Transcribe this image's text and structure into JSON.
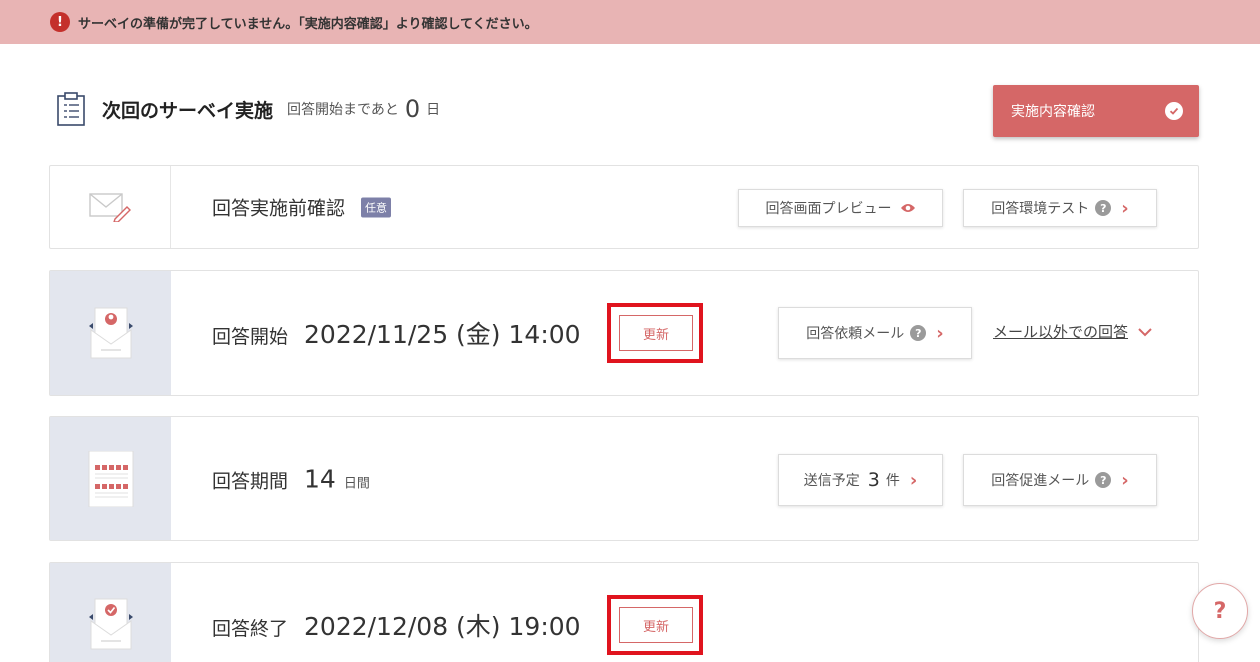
{
  "alert": {
    "icon": "exclamation-icon",
    "text": "サーベイの準備が完了していません。「実施内容確認」より確認してください。"
  },
  "header": {
    "title": "次回のサーベイ実施",
    "until_label": "回答開始まであと",
    "until_value": "0",
    "until_unit": "日",
    "confirm_button": "実施内容確認"
  },
  "precheck": {
    "label": "回答実施前確認",
    "badge": "任意",
    "preview_button": "回答画面プレビュー",
    "env_test_button": "回答環境テスト"
  },
  "start": {
    "label": "回答開始",
    "datetime": "2022/11/25 (金) 14:00",
    "update_button": "更新",
    "request_mail_button": "回答依頼メール",
    "other_link": "メール以外での回答"
  },
  "period": {
    "label": "回答期間",
    "value": "14",
    "unit": "日間",
    "scheduled_label": "送信予定",
    "scheduled_count": "3",
    "scheduled_unit": "件",
    "reminder_button": "回答促進メール"
  },
  "end": {
    "label": "回答終了",
    "datetime": "2022/12/08 (木) 19:00",
    "update_button": "更新"
  },
  "help_fab": "?",
  "colors": {
    "accent": "#d56767",
    "alert_bg": "#e8b4b4",
    "highlight": "#e0141e",
    "icon_cell": "#e3e6ee"
  }
}
